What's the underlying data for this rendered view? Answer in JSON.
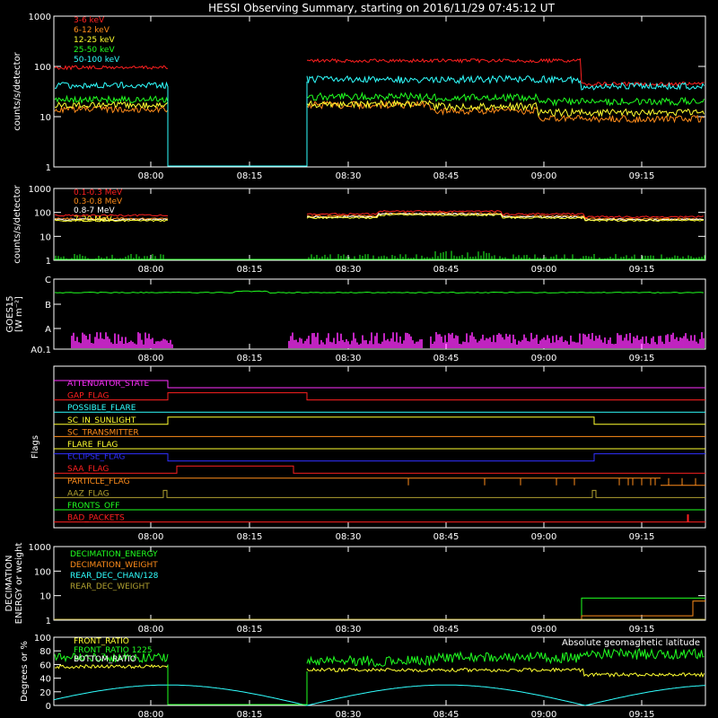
{
  "title": "HESSI Observing Summary, starting on 2016/11/29 07:45:12 UT",
  "colors": {
    "red": "#ff2020",
    "orange": "#ff8c1a",
    "yellow": "#ffff30",
    "green": "#20ff20",
    "cyan": "#30ffff",
    "magenta": "#ff30ff",
    "blue": "#3030ff",
    "olive": "#b0a030",
    "white": "#ffffff"
  },
  "chart_data": [
    {
      "type": "line",
      "id": "lightcurves",
      "ylabel": "counts/s/detector",
      "yscale": "log",
      "ylim": [
        1,
        1000
      ],
      "yticks": [
        "1",
        "10",
        "100",
        "1000"
      ],
      "xticks": [
        "08:00",
        "08:15",
        "08:30",
        "08:45",
        "09:00",
        "09:15"
      ],
      "series": [
        {
          "name": "3-6 keV",
          "color": "red"
        },
        {
          "name": "6-12 keV",
          "color": "orange"
        },
        {
          "name": "12-25 keV",
          "color": "yellow"
        },
        {
          "name": "25-50 keV",
          "color": "green"
        },
        {
          "name": "50-100 keV",
          "color": "cyan"
        }
      ]
    },
    {
      "type": "line",
      "id": "high_energy",
      "ylabel": "counts/s/detector",
      "yscale": "log",
      "ylim": [
        1,
        1000
      ],
      "yticks": [
        "1",
        "10",
        "100",
        "1000"
      ],
      "xticks": [
        "08:00",
        "08:15",
        "08:30",
        "08:45",
        "09:00",
        "09:15"
      ],
      "series": [
        {
          "name": "0.1-0.3 MeV",
          "color": "red"
        },
        {
          "name": "0.3-0.8 MeV",
          "color": "orange"
        },
        {
          "name": "0.8-7 MeV",
          "color": "white"
        },
        {
          "name": "7-20 MeV",
          "color": "yellow"
        }
      ]
    },
    {
      "type": "line",
      "id": "goes",
      "ylabel": "GOES15",
      "ylabel2": "[W m⁻²]",
      "yticks": [
        "A0.1",
        "A",
        "B",
        "C"
      ],
      "xticks": [
        "08:00",
        "08:15",
        "08:30",
        "08:45",
        "09:00",
        "09:15"
      ]
    },
    {
      "type": "line",
      "id": "flags",
      "ylabel": "Flags",
      "xticks": [
        "08:00",
        "08:15",
        "08:30",
        "08:45",
        "09:00",
        "09:15"
      ],
      "flags": [
        {
          "name": "ATTENUATOR_STATE",
          "color": "magenta"
        },
        {
          "name": "GAP_FLAG",
          "color": "red"
        },
        {
          "name": "POSSIBLE_FLARE",
          "color": "cyan"
        },
        {
          "name": "SC_IN_SUNLIGHT",
          "color": "yellow"
        },
        {
          "name": "SC_TRANSMITTER",
          "color": "orange"
        },
        {
          "name": "FLARE_FLAG",
          "color": "yellow"
        },
        {
          "name": "ECLIPSE_FLAG",
          "color": "blue"
        },
        {
          "name": "SAA_FLAG",
          "color": "red"
        },
        {
          "name": "PARTICLE_FLAG",
          "color": "orange"
        },
        {
          "name": "AAZ_FLAG",
          "color": "olive"
        },
        {
          "name": "FRONTS_OFF",
          "color": "green"
        },
        {
          "name": "BAD_PACKETS",
          "color": "red"
        }
      ]
    },
    {
      "type": "line",
      "id": "decimation",
      "ylabel": "DECIMATION",
      "ylabel2": "ENERGY or weight",
      "yscale": "log",
      "ylim": [
        1,
        1000
      ],
      "yticks": [
        "1",
        "10",
        "100",
        "1000"
      ],
      "xticks": [
        "08:00",
        "08:15",
        "08:30",
        "08:45",
        "09:00",
        "09:15"
      ],
      "series": [
        {
          "name": "DECIMATION_ENERGY",
          "color": "green"
        },
        {
          "name": "DECIMATION_WEIGHT",
          "color": "orange"
        },
        {
          "name": "REAR_DEC_CHAN/128",
          "color": "cyan"
        },
        {
          "name": "REAR_DEC_WEIGHT",
          "color": "olive"
        }
      ]
    },
    {
      "type": "line",
      "id": "ratio",
      "ylabel": "Degrees or %",
      "ylim": [
        0,
        100
      ],
      "yticks": [
        "0",
        "20",
        "40",
        "60",
        "80",
        "100"
      ],
      "xticks": [
        "08:00",
        "08:15",
        "08:30",
        "08:45",
        "09:00",
        "09:15"
      ],
      "series": [
        {
          "name": "FRONT_RATIO",
          "color": "yellow"
        },
        {
          "name": "FRONT_RATIO 1225",
          "color": "green"
        },
        {
          "name": "BOTTOM_RATIO",
          "color": "white"
        }
      ],
      "annotation": {
        "text": "Absolute geomagnetic latitude",
        "color": "cyan"
      }
    }
  ]
}
